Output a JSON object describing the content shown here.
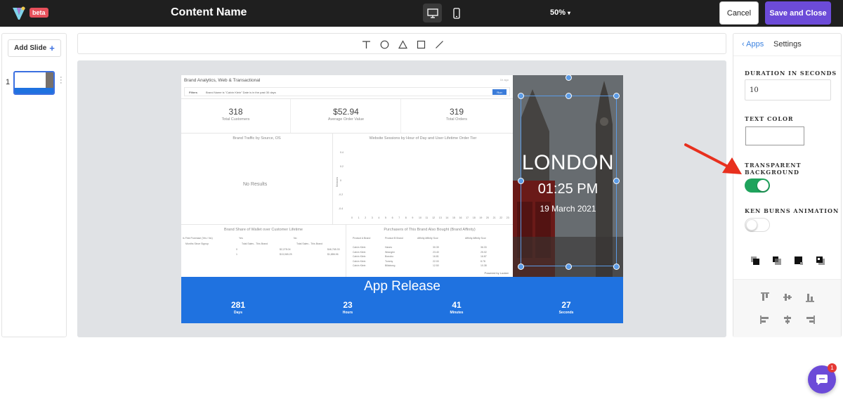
{
  "header": {
    "beta_badge": "beta",
    "content_name": "Content Name",
    "zoom": "50%",
    "cancel_label": "Cancel",
    "save_label": "Save and Close"
  },
  "left_panel": {
    "add_slide_label": "Add Slide",
    "slide_number": "1"
  },
  "toolbar": {
    "tools": [
      "text-tool",
      "circle-tool",
      "triangle-tool",
      "square-tool",
      "line-tool"
    ]
  },
  "slide": {
    "dashboard": {
      "title": "Brand Analytics, Web & Transactional",
      "ago": "1h ago",
      "filters_label": "Filters",
      "filters_text": "Brand Name is \"Calvin Klein\"   Date is in the past 30 days",
      "run_label": "Run",
      "kpis": [
        {
          "value": "318",
          "label": "Total Customers"
        },
        {
          "value": "$52.94",
          "label": "Average Order Value"
        },
        {
          "value": "319",
          "label": "Total Orders"
        }
      ],
      "traffic_title": "Brand Traffic by Source, OS",
      "no_results": "No Results",
      "sessions_title": "Website Sessions by Hour of Day and User Lifetime Order Tier",
      "y_ticks": [
        "0.4",
        "0.2",
        "0",
        "-0.2",
        "-0.4"
      ],
      "x_ticks": [
        "0",
        "1",
        "2",
        "3",
        "4",
        "5",
        "6",
        "7",
        "8",
        "9",
        "10",
        "11",
        "12",
        "13",
        "14",
        "15",
        "16",
        "17",
        "18",
        "19",
        "20",
        "21",
        "22",
        "23"
      ],
      "y_axis_label": "Sessions",
      "wallet_title": "Brand Share of Wallet over Customer Lifetime",
      "wallet_headers": [
        "Is First Purchase (Yes / No)",
        "Yes",
        "No"
      ],
      "wallet_sub": [
        "Months Since Signup",
        "Total Sales - This Brand",
        "Total Sales - This Brand"
      ],
      "wallet_rows": [
        [
          "0",
          "$2,278.04",
          "$46,765.33"
        ],
        [
          "1",
          "$13,065.25",
          "$1,886.96"
        ]
      ],
      "affinity_title": "Purchasers of This Brand Also Bought (Brand Affinity)",
      "affinity_headers": [
        "Product A Brand",
        "Product B Brand",
        "Affinity Affinity Score (by Order Basket)",
        "Affinity Affinity Score (by User History)"
      ],
      "affinity_rows": [
        [
          "Calvin Klein",
          "Hanes",
          "30.39",
          "36.33"
        ],
        [
          "Calvin Klein",
          "Wrangler",
          "23.40",
          "25.02"
        ],
        [
          "Calvin Klein",
          "Bonobo",
          "16.81",
          "16.87"
        ],
        [
          "Calvin Klein",
          "Tommy",
          "22.00",
          "8.78"
        ],
        [
          "Calvin Klein",
          "Billabong",
          "12.50",
          "10.38"
        ]
      ],
      "powered_by": "Powered by Looker"
    },
    "london": {
      "city": "LONDON",
      "time": "01:25 PM",
      "date": "19 March 2021"
    },
    "countdown": {
      "title": "App Release",
      "items": [
        {
          "value": "281",
          "label": "Days"
        },
        {
          "value": "23",
          "label": "Hours"
        },
        {
          "value": "41",
          "label": "Minutes"
        },
        {
          "value": "27",
          "label": "Seconds"
        }
      ],
      "color": "#1f72e0"
    }
  },
  "settings": {
    "apps_label": "Apps",
    "settings_label": "Settings",
    "duration_label": "DURATION IN SECONDS",
    "duration_value": "10",
    "text_color_label": "TEXT COLOR",
    "transparent_label_1": "TRANSPARENT",
    "transparent_label_2": "BACKGROUND",
    "transparent_on": true,
    "ken_burns_label": "KEN BURNS ANIMATION",
    "ken_burns_on": false,
    "toggle_on_color": "#1fa35c"
  },
  "chat": {
    "badge_count": "1"
  },
  "colors": {
    "accent": "#6c4bd8",
    "topbar": "#1f1f1f",
    "selection": "#5b9be6",
    "annotation_arrow": "#e8301e"
  }
}
